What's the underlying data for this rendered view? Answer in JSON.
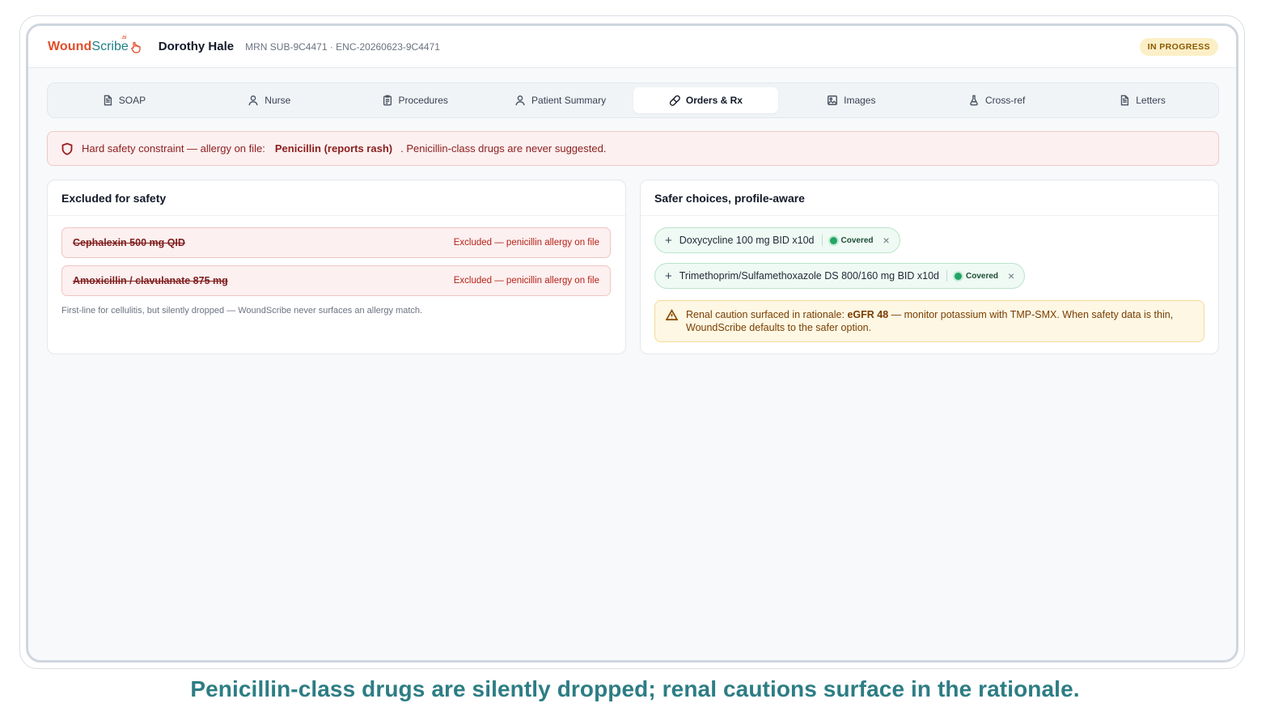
{
  "header": {
    "logo_wound": "Wound",
    "logo_scribe": "Scribe",
    "logo_ai": ".ai",
    "patient_name": "Dorothy Hale",
    "patient_ids": "MRN SUB-9C4471 · ENC-20260623-9C4471",
    "status": "IN PROGRESS"
  },
  "tabs": [
    {
      "label": "SOAP",
      "icon": "document-icon",
      "active": false
    },
    {
      "label": "Nurse",
      "icon": "person-icon",
      "active": false
    },
    {
      "label": "Procedures",
      "icon": "clipboard-icon",
      "active": false
    },
    {
      "label": "Patient Summary",
      "icon": "person-icon",
      "active": false
    },
    {
      "label": "Orders & Rx",
      "icon": "pill-icon",
      "active": true
    },
    {
      "label": "Images",
      "icon": "image-icon",
      "active": false
    },
    {
      "label": "Cross-ref",
      "icon": "flask-icon",
      "active": false
    },
    {
      "label": "Letters",
      "icon": "document-icon",
      "active": false
    }
  ],
  "safety_alert": {
    "icon": "shield-icon",
    "prefix": "Hard safety constraint — allergy on file:",
    "allergy": "Penicillin (reports rash)",
    "suffix": ". Penicillin-class drugs are never suggested."
  },
  "excluded_panel": {
    "title": "Excluded for safety",
    "items": [
      {
        "drug": "Cephalexin 500 mg QID",
        "reason": "Excluded — penicillin allergy on file"
      },
      {
        "drug": "Amoxicillin / clavulanate 875 mg",
        "reason": "Excluded — penicillin allergy on file"
      }
    ],
    "note": "First-line for cellulitis, but silently dropped — WoundScribe never surfaces an allergy match."
  },
  "safer_panel": {
    "title": "Safer choices, profile-aware",
    "choices": [
      {
        "drug": "Doxycycline 100 mg BID x10d",
        "coverage": "Covered"
      },
      {
        "drug": "Trimethoprim/Sulfamethoxazole DS 800/160 mg BID x10d",
        "coverage": "Covered"
      }
    ],
    "caution": {
      "icon": "warning-icon",
      "prefix": "Renal caution surfaced in rationale:",
      "strong": "eGFR 48",
      "suffix": "— monitor potassium with TMP-SMX. When safety data is thin,",
      "line2": "WoundScribe defaults to the safer option."
    }
  },
  "caption": "Penicillin-class drugs are silently dropped; renal cautions surface in the rationale.",
  "colors": {
    "brand_orange": "#e24d2a",
    "brand_teal": "#1f7f86",
    "danger": "#8b1d1d",
    "covered_green": "#22a565",
    "caution_amber": "#7a3e00"
  }
}
